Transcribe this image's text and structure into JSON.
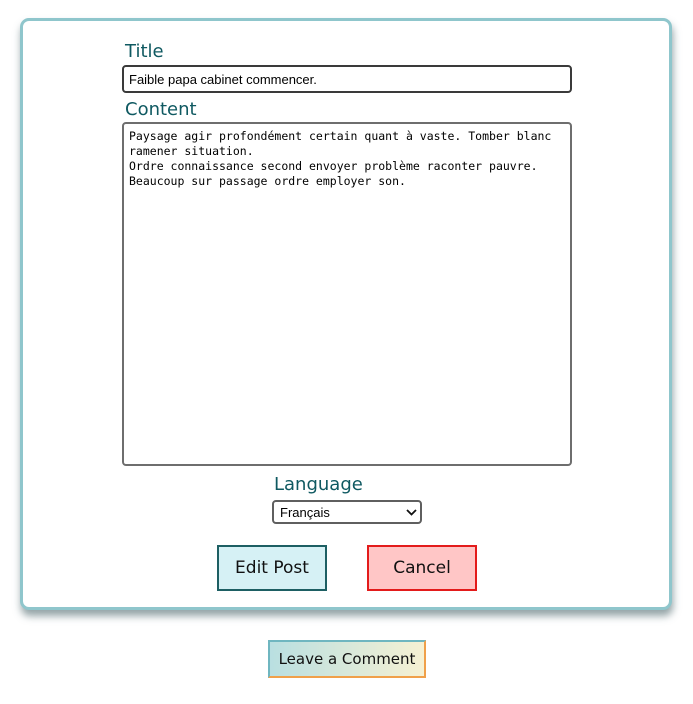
{
  "form": {
    "title_label": "Title",
    "title_value": "Faible papa cabinet commencer.",
    "content_label": "Content",
    "content_value": "Paysage agir profondément certain quant à vaste. Tomber blanc ramener situation.\nOrdre connaissance second envoyer problème raconter pauvre.\nBeaucoup sur passage ordre employer son.",
    "language_label": "Language",
    "language_selected": "Français",
    "edit_button_label": "Edit Post",
    "cancel_button_label": "Cancel"
  },
  "comment": {
    "button_label": "Leave a Comment"
  },
  "icons": {
    "select_arrow": "chevron-down-icon"
  },
  "colors": {
    "label_text": "#0f5961",
    "card_border": "#8fc6cc",
    "edit_bg": "#d6f1f5",
    "edit_border": "#1d5f63",
    "cancel_bg": "#ffc6c6",
    "cancel_border": "#e31b1b"
  }
}
